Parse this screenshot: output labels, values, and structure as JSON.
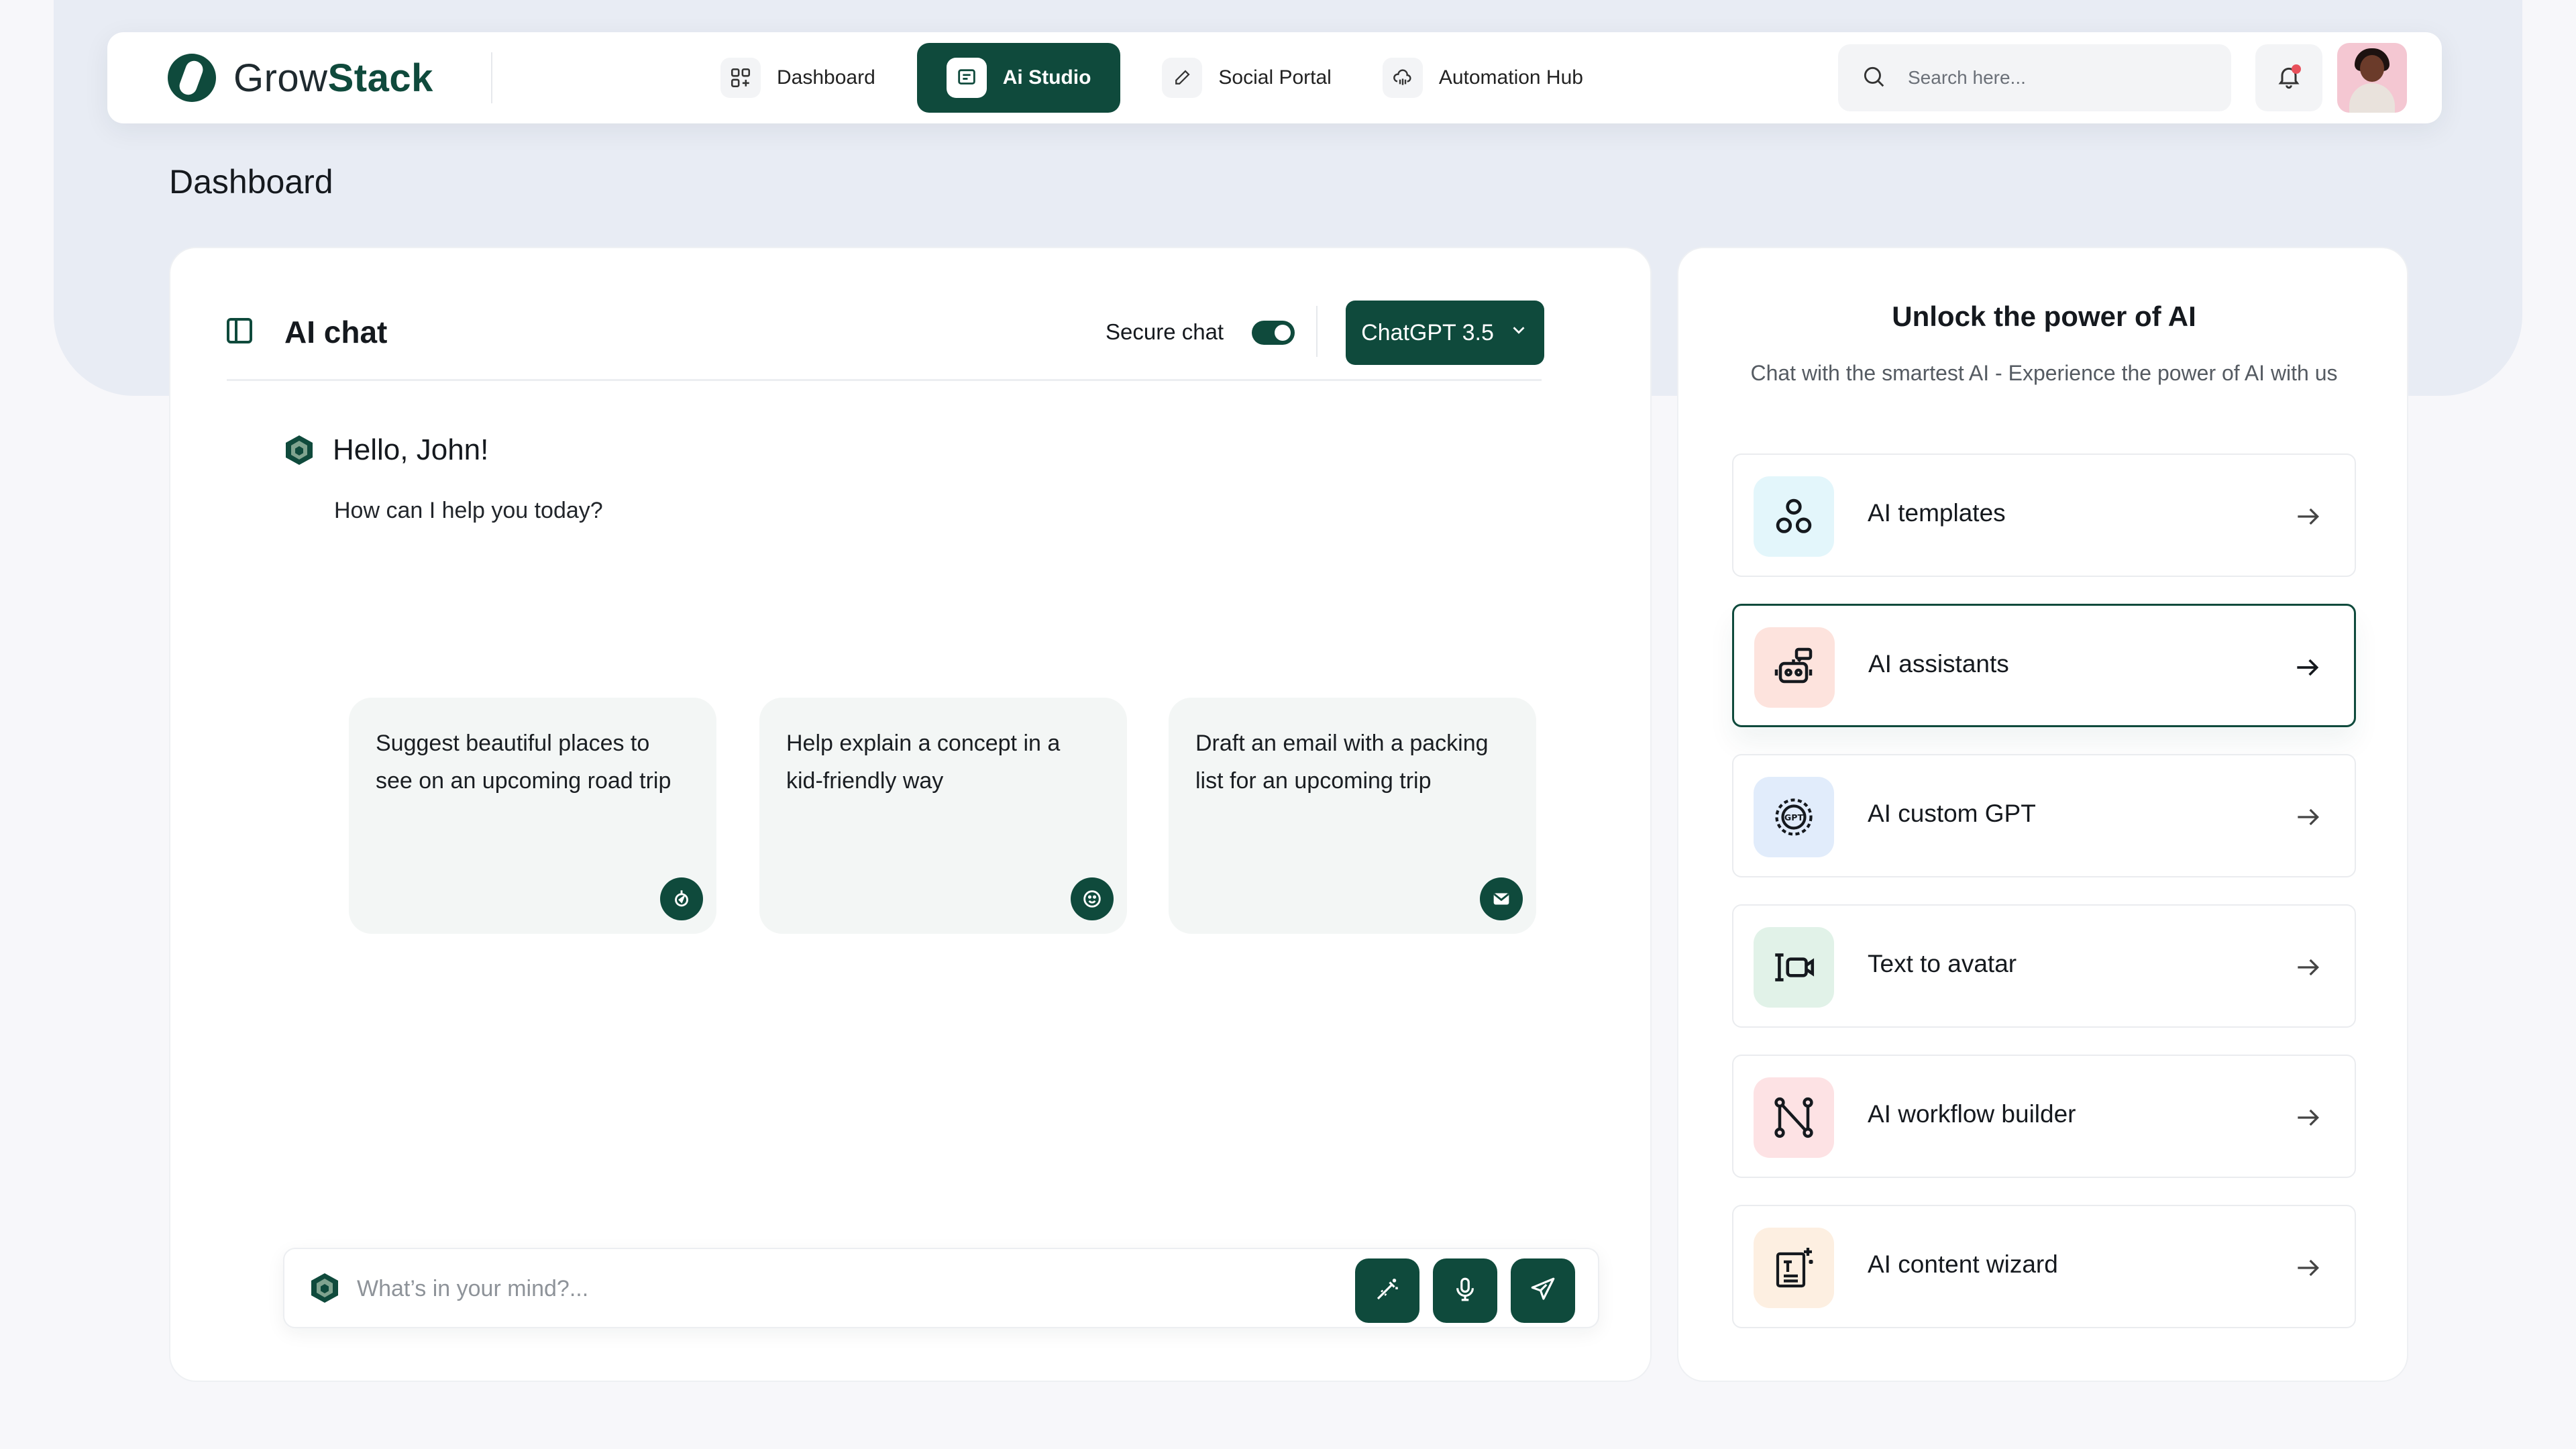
{
  "brand": {
    "name_part1": "Grow",
    "name_part2": "Stack"
  },
  "nav": {
    "items": [
      {
        "label": "Dashboard",
        "icon": "grid-icon",
        "active": false
      },
      {
        "label": "Ai Studio",
        "icon": "chat-icon",
        "active": true
      },
      {
        "label": "Social Portal",
        "icon": "pen-icon",
        "active": false
      },
      {
        "label": "Automation Hub",
        "icon": "cloud-icon",
        "active": false
      }
    ]
  },
  "search": {
    "placeholder": "Search here..."
  },
  "page": {
    "title": "Dashboard"
  },
  "chat": {
    "title": "AI chat",
    "secure_label": "Secure chat",
    "secure_enabled": true,
    "model": "ChatGPT 3.5",
    "greeting": "Hello, John!",
    "greeting_sub": "How can I help you today?",
    "suggestions": [
      {
        "text": "Suggest beautiful places to see on an upcoming road trip",
        "icon": "compass-icon"
      },
      {
        "text": "Help explain a concept in a kid-friendly way",
        "icon": "smile-icon"
      },
      {
        "text": "Draft an email with a packing list for an upcoming trip",
        "icon": "mail-icon"
      }
    ],
    "composer_placeholder": "What’s in your mind?..."
  },
  "tools": {
    "title": "Unlock the power of AI",
    "subtitle": "Chat with the smartest AI - Experience the power of AI with us",
    "items": [
      {
        "label": "AI templates",
        "icon": "templates-icon",
        "bg": "#e3f6fb"
      },
      {
        "label": "AI assistants",
        "icon": "robot-icon",
        "bg": "#fde3dd",
        "selected": true
      },
      {
        "label": "AI custom GPT",
        "icon": "gpt-icon",
        "bg": "#e1ecfb"
      },
      {
        "label": "Text to avatar",
        "icon": "avatar-video-icon",
        "bg": "#e1f2e8"
      },
      {
        "label": "AI workflow builder",
        "icon": "workflow-icon",
        "bg": "#fde2e4"
      },
      {
        "label": "AI content wizard",
        "icon": "wizard-icon",
        "bg": "#fdefe1"
      }
    ]
  },
  "colors": {
    "accent": "#0f4a3c",
    "notification": "#e8505b"
  }
}
